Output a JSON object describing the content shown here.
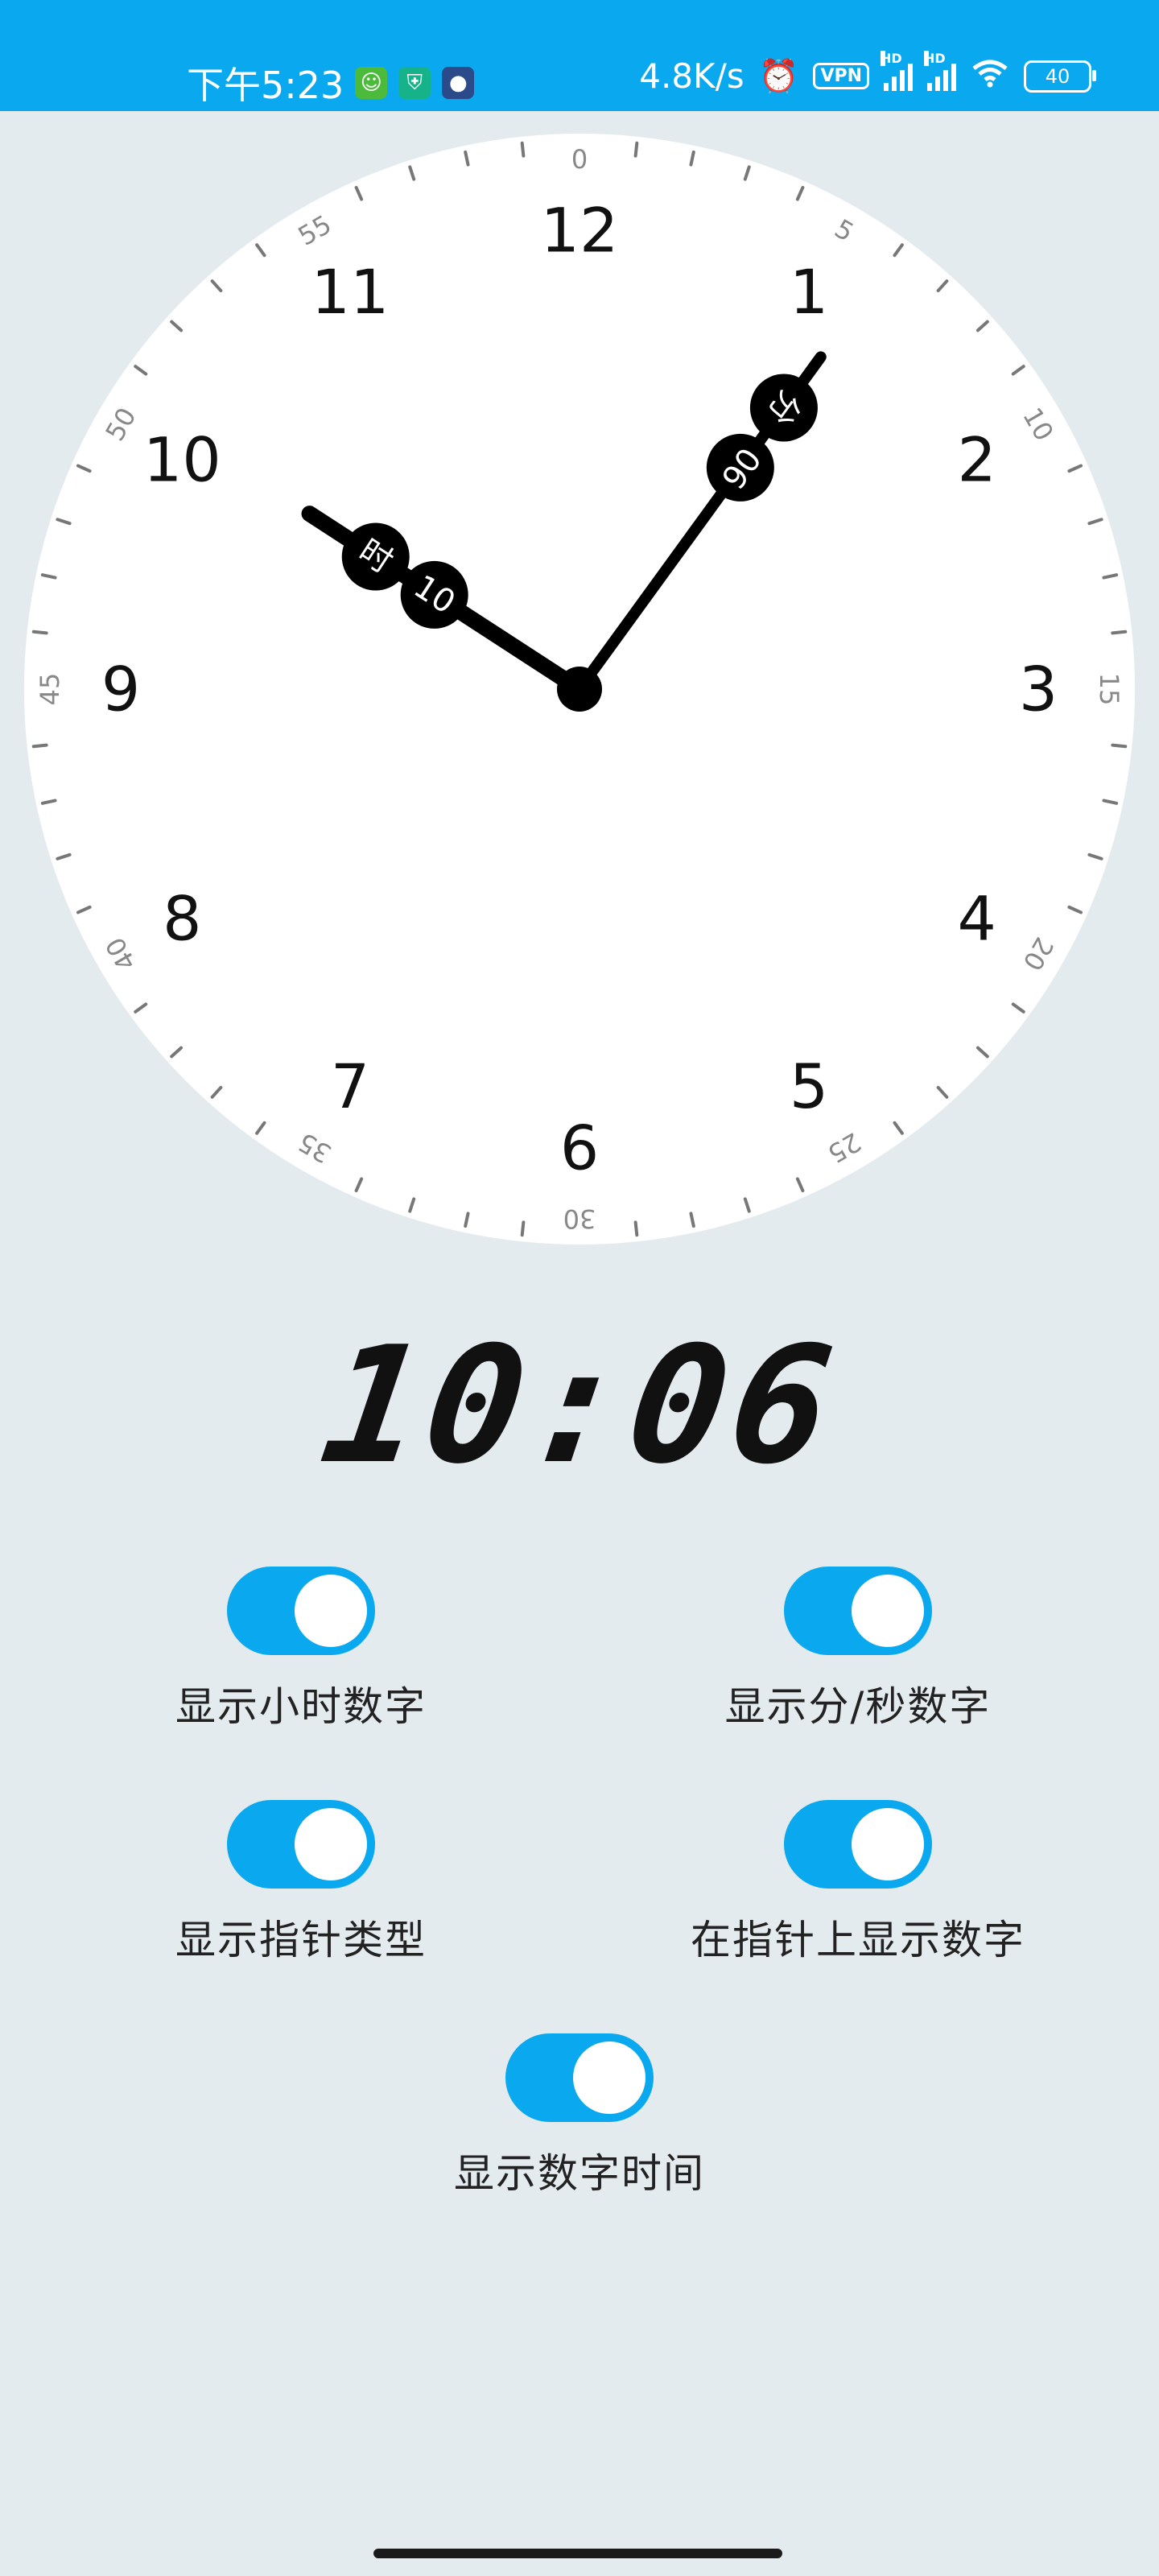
{
  "status_bar": {
    "time": "下午5:23",
    "net_speed": "4.8K/s",
    "vpn": "VPN",
    "hd1": "HD",
    "hd2": "HD",
    "battery": "40",
    "icons": [
      "android-icon",
      "shield-icon",
      "cat-icon",
      "alarm-icon",
      "signal-icon",
      "signal-icon",
      "wifi-icon",
      "battery-icon"
    ]
  },
  "clock": {
    "hour_numbers": [
      "12",
      "1",
      "2",
      "3",
      "4",
      "5",
      "6",
      "7",
      "8",
      "9",
      "10",
      "11"
    ],
    "minute_labels": [
      "0",
      "5",
      "10",
      "15",
      "20",
      "25",
      "30",
      "35",
      "40",
      "45",
      "50",
      "55"
    ],
    "hour_value": 10,
    "minute_value": 6,
    "hour_hand_label_unit": "时",
    "hour_hand_label_value": "10",
    "minute_hand_label_unit": "分",
    "minute_hand_label_value": "06"
  },
  "digital_time": "10:06",
  "toggles": [
    {
      "label": "显示小时数字",
      "on": true
    },
    {
      "label": "显示分/秒数字",
      "on": true
    },
    {
      "label": "显示指针类型",
      "on": true
    },
    {
      "label": "在指针上显示数字",
      "on": true
    },
    {
      "label": "显示数字时间",
      "on": true
    }
  ],
  "colors": {
    "accent": "#0aa8ee",
    "background": "#e4ebef",
    "clock_face": "#ffffff",
    "hands": "#000000",
    "tick": "#777777"
  }
}
